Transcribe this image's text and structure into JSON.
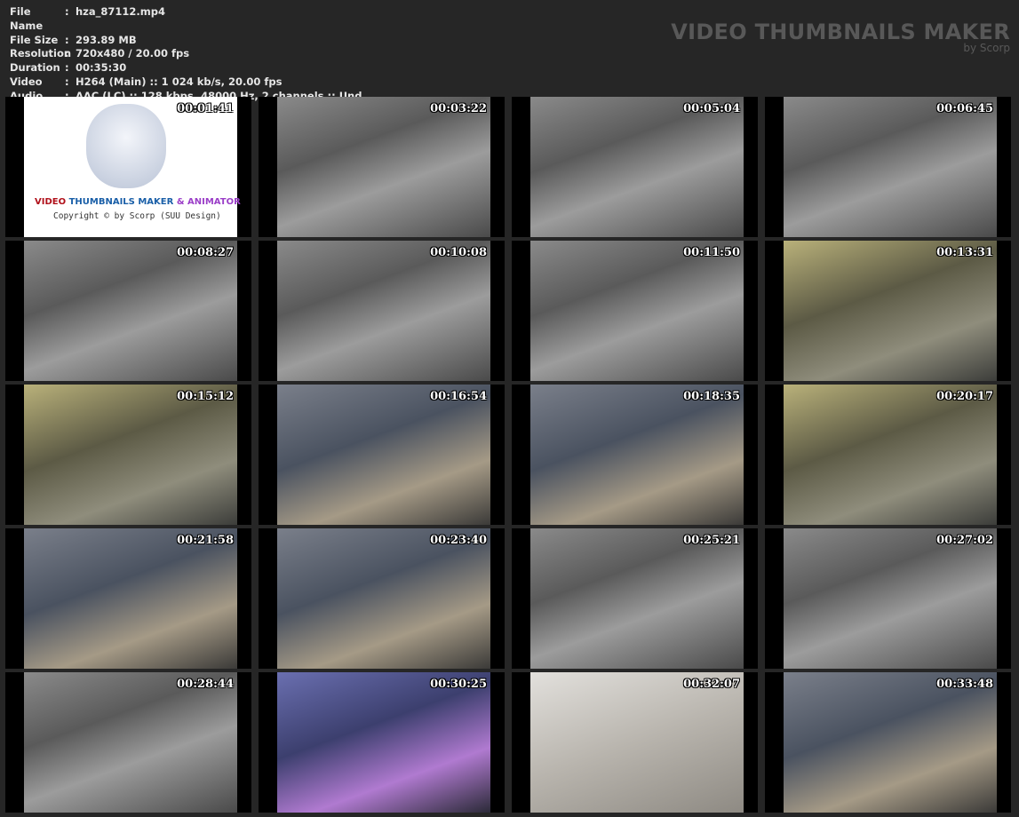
{
  "info": [
    {
      "key": "File Name",
      "value": "hza_87112.mp4"
    },
    {
      "key": "File Size",
      "value": "293.89 MB"
    },
    {
      "key": "Resolution",
      "value": "720x480 / 20.00 fps"
    },
    {
      "key": "Duration",
      "value": "00:35:30"
    },
    {
      "key": "Video",
      "value": "H264 (Main) :: 1 024 kb/s, 20.00 fps"
    },
    {
      "key": "Audio",
      "value": "AAC (LC) :: 128 kbps, 48000 Hz, 2 channels :: Und"
    }
  ],
  "separator": ":",
  "brand": {
    "title": "VIDEO THUMBNAILS MAKER",
    "subtitle": "by Scorp"
  },
  "logo": {
    "video": "VIDEO ",
    "thumbs": "THUMBNAILS MAKER ",
    "animator": "& ANIMATOR",
    "copyright": "Copyright © by Scorp (SUU Design)"
  },
  "thumbnails": [
    {
      "time": "00:01:41",
      "style": "logo"
    },
    {
      "time": "00:03:22",
      "style": "gray"
    },
    {
      "time": "00:05:04",
      "style": "gray"
    },
    {
      "time": "00:06:45",
      "style": "gray"
    },
    {
      "time": "00:08:27",
      "style": "gray"
    },
    {
      "time": "00:10:08",
      "style": "gray"
    },
    {
      "time": "00:11:50",
      "style": "gray"
    },
    {
      "time": "00:13:31",
      "style": "yellow"
    },
    {
      "time": "00:15:12",
      "style": "yellow"
    },
    {
      "time": "00:16:54",
      "style": "color"
    },
    {
      "time": "00:18:35",
      "style": "color"
    },
    {
      "time": "00:20:17",
      "style": "yellow"
    },
    {
      "time": "00:21:58",
      "style": "color"
    },
    {
      "time": "00:23:40",
      "style": "color"
    },
    {
      "time": "00:25:21",
      "style": "gray"
    },
    {
      "time": "00:27:02",
      "style": "gray"
    },
    {
      "time": "00:28:44",
      "style": "gray"
    },
    {
      "time": "00:30:25",
      "style": "purple"
    },
    {
      "time": "00:32:07",
      "style": "bright"
    },
    {
      "time": "00:33:48",
      "style": "color"
    }
  ]
}
